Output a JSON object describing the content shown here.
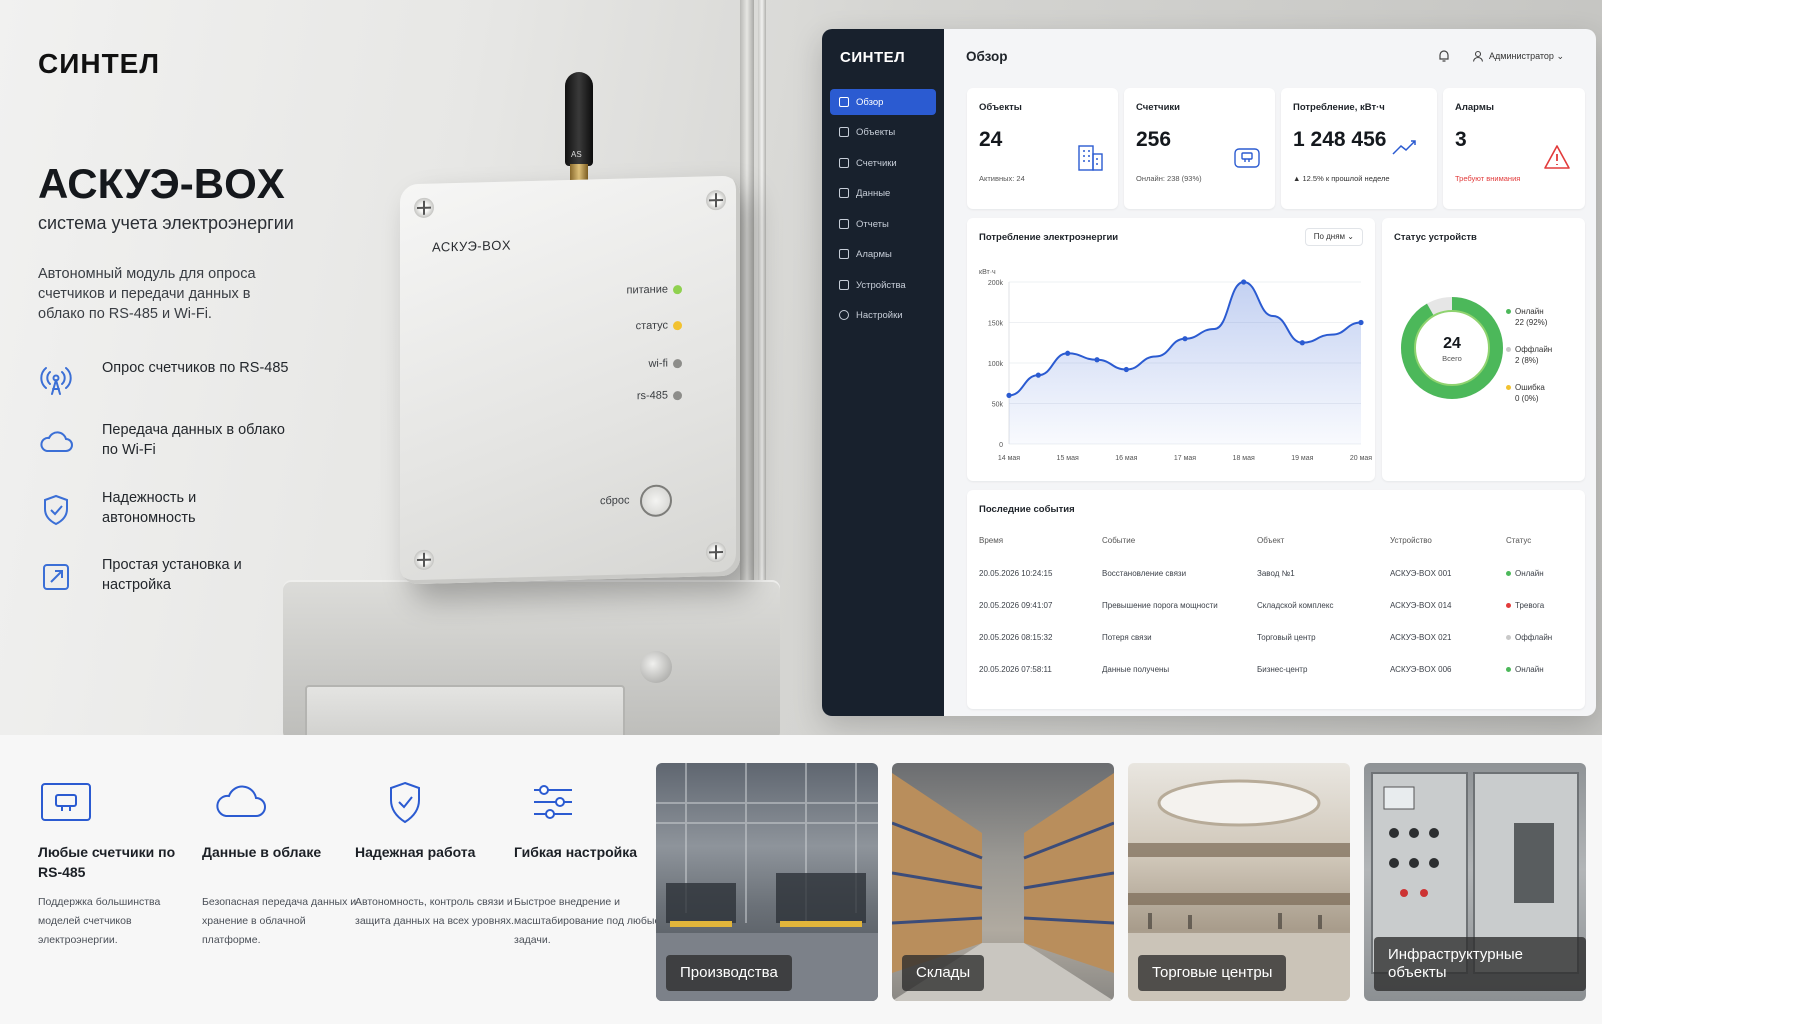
{
  "hero": {
    "brand": "СИНТЕЛ",
    "product_title": "АСКУЭ-BOX",
    "product_subtitle": "система учета электроэнергии",
    "description": "Автономный модуль для опроса счетчиков и передачи данных в облако по RS-485 и Wi-Fi.",
    "features": [
      {
        "icon": "signal-tower-icon",
        "text": "Опрос счетчиков по RS-485"
      },
      {
        "icon": "cloud-icon",
        "text": "Передача данных в облако по Wi-Fi"
      },
      {
        "icon": "shield-check-icon",
        "text": "Надежность и автономность"
      },
      {
        "icon": "external-link-icon",
        "text": "Простая установка и настройка"
      }
    ]
  },
  "device": {
    "antenna_logo": "AS",
    "label": "АСКУЭ-BOX",
    "leds": [
      {
        "label": "питание",
        "color": "#8fd14f"
      },
      {
        "label": "статус",
        "color": "#f2c230"
      },
      {
        "label": "wi-fi",
        "color": "#8d8d8a"
      },
      {
        "label": "rs-485",
        "color": "#8d8d8a"
      }
    ],
    "reset_label": "сброс"
  },
  "dashboard": {
    "brand": "СИНТЕЛ",
    "page_title": "Обзор",
    "user": "Администратор",
    "nav": [
      {
        "label": "Обзор",
        "active": true
      },
      {
        "label": "Объекты",
        "active": false
      },
      {
        "label": "Счетчики",
        "active": false
      },
      {
        "label": "Данные",
        "active": false
      },
      {
        "label": "Отчеты",
        "active": false
      },
      {
        "label": "Алармы",
        "active": false
      },
      {
        "label": "Устройства",
        "active": false
      },
      {
        "label": "Настройки",
        "active": false
      }
    ],
    "kpis": [
      {
        "label": "Объекты",
        "value": "24",
        "sub": "Активных: 24",
        "icon": "building-icon",
        "color": "#2b5bd1"
      },
      {
        "label": "Счетчики",
        "value": "256",
        "sub": "Онлайн: 238 (93%)",
        "icon": "meter-icon",
        "color": "#2b5bd1"
      },
      {
        "label": "Потребление, кВт·ч",
        "value": "1 248 456",
        "sub": "▲ 12.5% к прошлой неделе",
        "icon": "trend-up-icon",
        "color": "#2b5bd1"
      },
      {
        "label": "Алармы",
        "value": "3",
        "sub": "Требуют внимания",
        "icon": "warning-icon",
        "color": "#e23b3b"
      }
    ],
    "consumption": {
      "title": "Потребление электроэнергии",
      "period": "По дням",
      "unit": "кВт·ч"
    },
    "status": {
      "title": "Статус устройств",
      "total": "24",
      "total_label": "Всего",
      "items": [
        {
          "label": "Онлайн",
          "value": "22 (92%)",
          "color": "#4cb85a"
        },
        {
          "label": "Оффлайн",
          "value": "2 (8%)",
          "color": "#c9c9c9"
        },
        {
          "label": "Ошибка",
          "value": "0 (0%)",
          "color": "#f2c230"
        }
      ]
    },
    "events": {
      "title": "Последние события",
      "columns": [
        "Время",
        "Событие",
        "Объект",
        "Устройство",
        "Статус"
      ],
      "rows": [
        {
          "time": "20.05.2026 10:24:15",
          "event": "Восстановление связи",
          "object": "Завод №1",
          "device": "АСКУЭ-BOX 001",
          "status": "Онлайн",
          "color": "#4cb85a"
        },
        {
          "time": "20.05.2026 09:41:07",
          "event": "Превышение порога мощности",
          "object": "Складской комплекс",
          "device": "АСКУЭ-BOX 014",
          "status": "Тревога",
          "color": "#e23b3b"
        },
        {
          "time": "20.05.2026 08:15:32",
          "event": "Потеря связи",
          "object": "Торговый центр",
          "device": "АСКУЭ-BOX 021",
          "status": "Оффлайн",
          "color": "#c9c9c9"
        },
        {
          "time": "20.05.2026 07:58:11",
          "event": "Данные получены",
          "object": "Бизнес-центр",
          "device": "АСКУЭ-BOX 006",
          "status": "Онлайн",
          "color": "#4cb85a"
        }
      ]
    }
  },
  "chart_data": {
    "type": "area",
    "categories": [
      "14 мая",
      "15 мая",
      "16 мая",
      "17 мая",
      "18 мая",
      "19 мая",
      "20 мая"
    ],
    "x": [
      0,
      0.5,
      1,
      1.5,
      2,
      2.5,
      3,
      3.5,
      4,
      4.5,
      5,
      5.5,
      6
    ],
    "values": [
      60000,
      85000,
      112000,
      104000,
      92000,
      108000,
      130000,
      142000,
      200000,
      158000,
      125000,
      135000,
      150000
    ],
    "ylim": [
      0,
      200000
    ],
    "yticks": [
      "0",
      "50k",
      "100k",
      "150k",
      "200k"
    ],
    "ylabel": "кВт·ч",
    "grid": true,
    "color": "#2b5bd1"
  },
  "bottom": {
    "features": [
      {
        "icon": "meter-icon",
        "title": "Любые счетчики по RS-485",
        "desc": "Поддержка большинства моделей счетчиков электроэнергии."
      },
      {
        "icon": "cloud-icon",
        "title": "Данные в облаке",
        "desc": "Безопасная передача данных и хранение в облачной платформе."
      },
      {
        "icon": "shield-check-icon",
        "title": "Надежная работа",
        "desc": "Автономность, контроль связи и защита данных на всех уровнях."
      },
      {
        "icon": "sliders-icon",
        "title": "Гибкая настройка",
        "desc": "Быстрое внедрение и масштабирование под любые задачи."
      }
    ],
    "tiles": [
      {
        "label": "Производства"
      },
      {
        "label": "Склады"
      },
      {
        "label": "Торговые центры"
      },
      {
        "label": "Инфраструктурные объекты"
      }
    ]
  }
}
